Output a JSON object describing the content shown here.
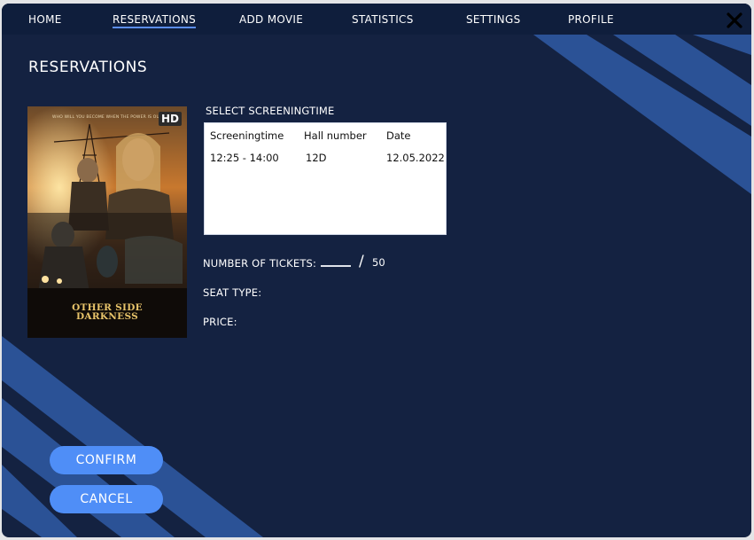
{
  "nav": {
    "items": [
      {
        "label": "HOME"
      },
      {
        "label": "RESERVATIONS"
      },
      {
        "label": "ADD MOVIE"
      },
      {
        "label": "STATISTICS"
      },
      {
        "label": "SETTINGS"
      },
      {
        "label": "PROFILE"
      }
    ],
    "active": "RESERVATIONS"
  },
  "page": {
    "title": "RESERVATIONS"
  },
  "poster": {
    "badge": "HD",
    "tagline": "WHO WILL YOU BECOME WHEN THE POWER IS OUT",
    "title_line1": "OTHER SIDE",
    "title_line2": "DARKNESS"
  },
  "screening": {
    "label": "SELECT SCREENINGTIME",
    "columns": [
      "Screeningtime",
      "Hall number",
      "Date"
    ],
    "rows": [
      [
        "12:25 - 14:00",
        "12D",
        "12.05.2022"
      ]
    ]
  },
  "form": {
    "tickets_label": "NUMBER OF TICKETS:",
    "tickets_value": "",
    "separator": "/",
    "tickets_max": "50",
    "seat_type_label": "SEAT TYPE:",
    "price_label": "PRICE:"
  },
  "buttons": {
    "confirm": "CONFIRM",
    "cancel": "CANCEL"
  },
  "colors": {
    "background": "#142241",
    "navbar": "#0f1e3c",
    "stripe": "#2e5ba8",
    "accent_button": "#4f8ef7",
    "table_bg": "#ffffff"
  },
  "icons": {
    "close": "close-icon"
  }
}
